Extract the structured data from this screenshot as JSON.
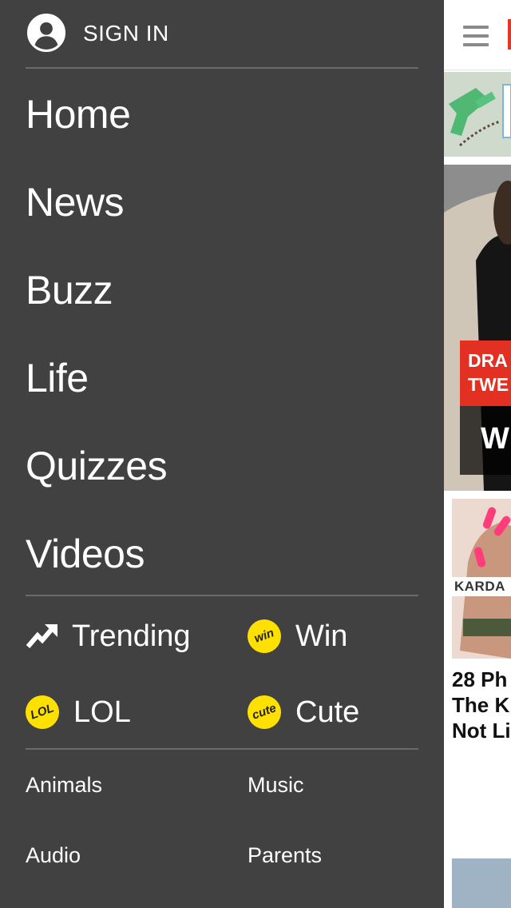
{
  "drawer": {
    "sign_in_label": "SIGN IN",
    "nav_items": [
      "Home",
      "News",
      "Buzz",
      "Life",
      "Quizzes",
      "Videos"
    ],
    "tags": [
      {
        "label": "Trending",
        "icon": "trending-arrow-icon"
      },
      {
        "label": "Win",
        "icon": "win-badge-icon",
        "badge_text": "win"
      },
      {
        "label": "LOL",
        "icon": "lol-badge-icon",
        "badge_text": "LOL"
      },
      {
        "label": "Cute",
        "icon": "cute-badge-icon",
        "badge_text": "cute"
      }
    ],
    "categories": [
      "Animals",
      "Music",
      "Audio",
      "Parents"
    ]
  },
  "content": {
    "hero_tag_lines": [
      "DRA",
      "TWE"
    ],
    "hero_title": "W",
    "card_caption": "KARDA",
    "card_title_lines": [
      "28 Ph",
      "The K",
      "Not Li"
    ]
  },
  "colors": {
    "drawer_bg": "#414141",
    "badge_yellow": "#ffe100",
    "accent_red": "#e23022"
  }
}
